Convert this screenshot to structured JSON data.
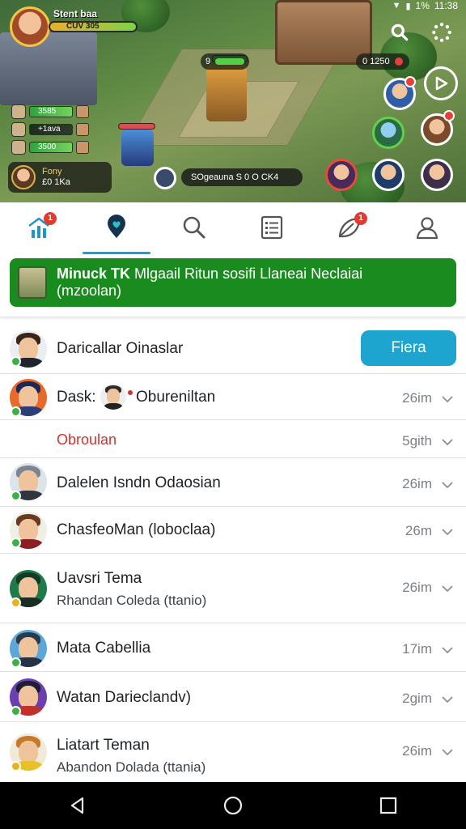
{
  "status_bar": {
    "time": "11:38",
    "battery": "1%"
  },
  "game_banner": {
    "player_title": "Stent baa",
    "player_bar_value": "CUV 305",
    "level_badge": "9",
    "resource_count": "0 1250",
    "side_rows": [
      {
        "value": "3585"
      },
      {
        "value": "+1ava"
      },
      {
        "value": "3500"
      }
    ],
    "player_card": {
      "name": "Fony",
      "detail": "£0 1Ka"
    },
    "event_text": "SOgeauna  S 0 O CK4"
  },
  "tabs": [
    {
      "name": "home",
      "badge": "1",
      "active": false
    },
    {
      "name": "map",
      "badge": "",
      "active": true
    },
    {
      "name": "search",
      "badge": "",
      "active": false
    },
    {
      "name": "list",
      "badge": "",
      "active": false
    },
    {
      "name": "alerts",
      "badge": "1",
      "active": false
    },
    {
      "name": "profile",
      "badge": "",
      "active": false
    }
  ],
  "promo": {
    "bold": "Minuck TK",
    "text": " Mlgaail Ritun sosifi Llaneai Neclaiai",
    "line2": "(mzoolan)"
  },
  "chats": [
    {
      "name": "Daricallar Oinaslar",
      "cta": "Fiera"
    },
    {
      "name_prefix": "Dask:",
      "name": "Obureniltan",
      "time": "26im"
    },
    {
      "name": "Obroulan",
      "time": "5gith"
    },
    {
      "name": "Dalelen Isndn Odaosian",
      "time": "26im"
    },
    {
      "name": "ChasfeoMan (loboclaa)",
      "time": "26m"
    },
    {
      "name": "Uavsri Tema",
      "sub": "Rhandan Coleda (ttanio)",
      "time": "26im"
    },
    {
      "name": "Mata Cabellia",
      "time": "17im"
    },
    {
      "name": "Watan Darieclandv)",
      "time": "2gim"
    },
    {
      "name": "Liatart Teman",
      "sub": "Abandon Dolada (ttania)",
      "time": "26im"
    }
  ],
  "colors": {
    "accent": "#1da5cf",
    "promo_green": "#1a8c1f",
    "badge_red": "#e23a2f",
    "online_green": "#3bb143",
    "away_yellow": "#e8b31a"
  }
}
